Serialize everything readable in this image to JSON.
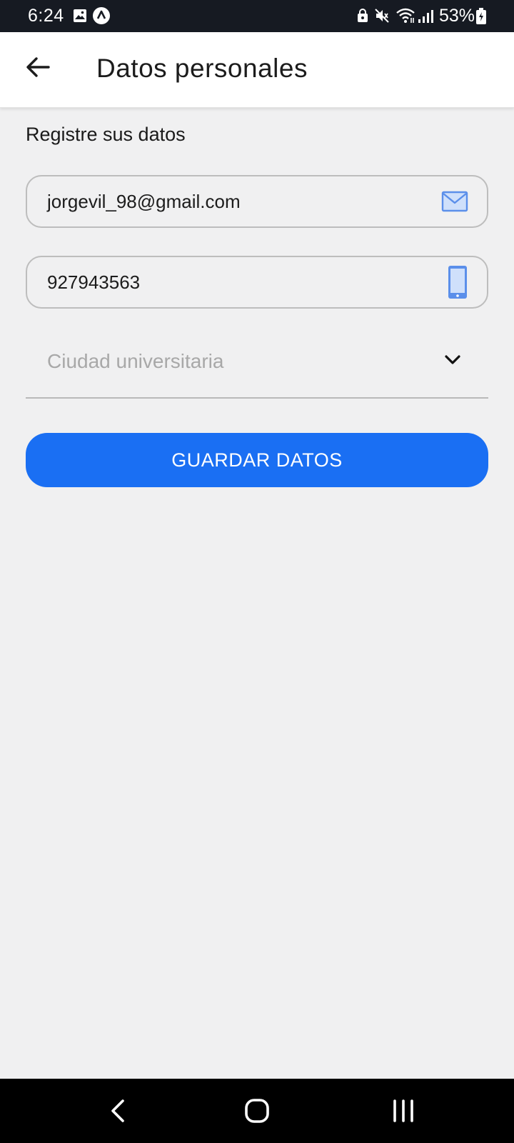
{
  "status_bar": {
    "time": "6:24",
    "battery": "53%",
    "icons": [
      "gallery-icon",
      "app-icon",
      "lock-icon",
      "mute-icon",
      "wifi-icon",
      "signal-icon",
      "battery-icon"
    ]
  },
  "app_bar": {
    "title": "Datos personales",
    "back_icon": "arrow-back-icon"
  },
  "form": {
    "subtitle": "Registre sus datos",
    "email": {
      "value": "jorgevil_98@gmail.com",
      "icon": "mail-icon"
    },
    "phone": {
      "value": "927943563",
      "icon": "phone-icon"
    },
    "city_select": {
      "placeholder": "Ciudad universitaria",
      "icon": "chevron-down-icon"
    },
    "submit_label": "GUARDAR DATOS"
  },
  "colors": {
    "status_bar_bg": "#161a22",
    "primary": "#1a6ff3",
    "background": "#f0f0f1",
    "icon_blue": "#5b8fea",
    "nav_bar_bg": "#000000"
  }
}
